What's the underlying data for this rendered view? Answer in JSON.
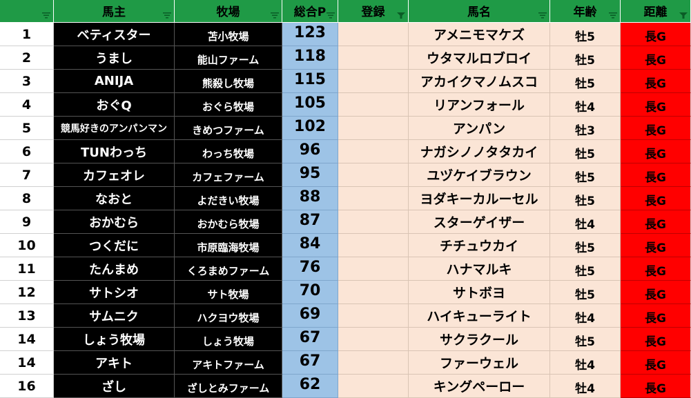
{
  "header": {
    "col_index": "",
    "owner": "馬主",
    "farm": "牧場",
    "points": "総合P",
    "register": "登録",
    "horse": "馬名",
    "age": "年齢",
    "distance": "距離"
  },
  "icons": {
    "filter_dropdown": "filter-dropdown-icon",
    "filter_active": "filter-active-icon"
  },
  "colors": {
    "header_bg": "#1f9a46",
    "owner_bg": "#000000",
    "points_bg": "#9dc3e6",
    "horse_bg": "#fbe5d6",
    "distance_bg": "#ff0000"
  },
  "rows": [
    {
      "rank": "1",
      "owner": "ベティスター",
      "farm": "苫小牧場",
      "points": "123",
      "register": "",
      "horse": "アメニモマケズ",
      "age": "牡5",
      "distance": "長G"
    },
    {
      "rank": "2",
      "owner": "うまし",
      "farm": "能山ファーム",
      "points": "118",
      "register": "",
      "horse": "ウタマルロブロイ",
      "age": "牡5",
      "distance": "長G"
    },
    {
      "rank": "3",
      "owner": "ANIJA",
      "farm": "熊殺し牧場",
      "points": "115",
      "register": "",
      "horse": "アカイクマノムスコ",
      "age": "牡5",
      "distance": "長G"
    },
    {
      "rank": "4",
      "owner": "おぐQ",
      "farm": "おぐら牧場",
      "points": "105",
      "register": "",
      "horse": "リアンフォール",
      "age": "牡4",
      "distance": "長G"
    },
    {
      "rank": "5",
      "owner": "競馬好きのアンパンマン",
      "farm": "きめつファーム",
      "points": "102",
      "register": "",
      "horse": "アンパン",
      "age": "牡3",
      "distance": "長G"
    },
    {
      "rank": "6",
      "owner": "TUNわっち",
      "farm": "わっち牧場",
      "points": "96",
      "register": "",
      "horse": "ナガシノノタタカイ",
      "age": "牡5",
      "distance": "長G"
    },
    {
      "rank": "7",
      "owner": "カフェオレ",
      "farm": "カフェファーム",
      "points": "95",
      "register": "",
      "horse": "ユヅケイブラウン",
      "age": "牡5",
      "distance": "長G"
    },
    {
      "rank": "8",
      "owner": "なおと",
      "farm": "よだきい牧場",
      "points": "88",
      "register": "",
      "horse": "ヨダキーカルーセル",
      "age": "牡5",
      "distance": "長G"
    },
    {
      "rank": "9",
      "owner": "おかむら",
      "farm": "おかむら牧場",
      "points": "87",
      "register": "",
      "horse": "スターゲイザー",
      "age": "牡4",
      "distance": "長G"
    },
    {
      "rank": "10",
      "owner": "つくだに",
      "farm": "市原臨海牧場",
      "points": "84",
      "register": "",
      "horse": "チチュウカイ",
      "age": "牡5",
      "distance": "長G"
    },
    {
      "rank": "11",
      "owner": "たんまめ",
      "farm": "くろまめファーム",
      "points": "76",
      "register": "",
      "horse": "ハナマルキ",
      "age": "牡5",
      "distance": "長G"
    },
    {
      "rank": "12",
      "owner": "サトシオ",
      "farm": "サト牧場",
      "points": "70",
      "register": "",
      "horse": "サトボヨ",
      "age": "牡5",
      "distance": "長G"
    },
    {
      "rank": "13",
      "owner": "サムニク",
      "farm": "ハクヨウ牧場",
      "points": "69",
      "register": "",
      "horse": "ハイキューライト",
      "age": "牡4",
      "distance": "長G"
    },
    {
      "rank": "14",
      "owner": "しょう牧場",
      "farm": "しょう牧場",
      "points": "67",
      "register": "",
      "horse": "サクラクール",
      "age": "牡5",
      "distance": "長G"
    },
    {
      "rank": "14",
      "owner": "アキト",
      "farm": "アキトファーム",
      "points": "67",
      "register": "",
      "horse": "ファーウェル",
      "age": "牡4",
      "distance": "長G"
    },
    {
      "rank": "16",
      "owner": "ざし",
      "farm": "ざしとみファーム",
      "points": "62",
      "register": "",
      "horse": "キングペーロー",
      "age": "牡4",
      "distance": "長G"
    }
  ]
}
